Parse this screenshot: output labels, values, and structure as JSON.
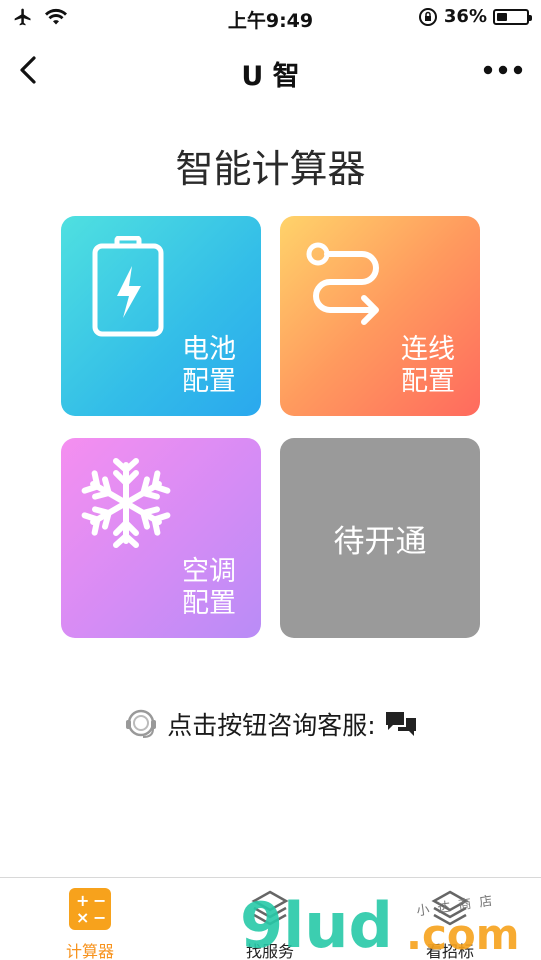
{
  "status_bar": {
    "time": "上午9:49",
    "battery_percent": "36%",
    "battery_level": 0.36
  },
  "nav": {
    "title": "U 智",
    "back_icon": "chevron-left-icon",
    "more_icon": "more-dots-icon"
  },
  "page": {
    "title": "智能计算器"
  },
  "cards": {
    "battery": {
      "line1": "电池",
      "line2": "配置",
      "icon": "battery-bolt-icon"
    },
    "wiring": {
      "line1": "连线",
      "line2": "配置",
      "icon": "wire-route-icon"
    },
    "ac": {
      "line1": "空调",
      "line2": "配置",
      "icon": "snowflake-icon"
    },
    "pending": {
      "label": "待开通"
    }
  },
  "contact": {
    "text": "点击按钮咨询客服:",
    "headset_icon": "headset-icon",
    "chat_icon": "chat-bubbles-icon"
  },
  "tab_bar": {
    "tabs": [
      {
        "label": "计算器",
        "icon": "calculator-icon",
        "active": true,
        "color": "#f7931e"
      },
      {
        "label": "找服务",
        "icon": "service-icon",
        "active": false
      },
      {
        "label": "看招标",
        "icon": "bid-icon",
        "active": false
      }
    ]
  },
  "watermark": {
    "text": "9lud.com",
    "subtext": "小 达 商 店"
  },
  "colors": {
    "accent": "#f7931e",
    "battery_card": "#33bde8",
    "wiring_card": "#ff8a5e",
    "ac_card": "#d58cf5",
    "pending_card": "#9a9a9a"
  }
}
